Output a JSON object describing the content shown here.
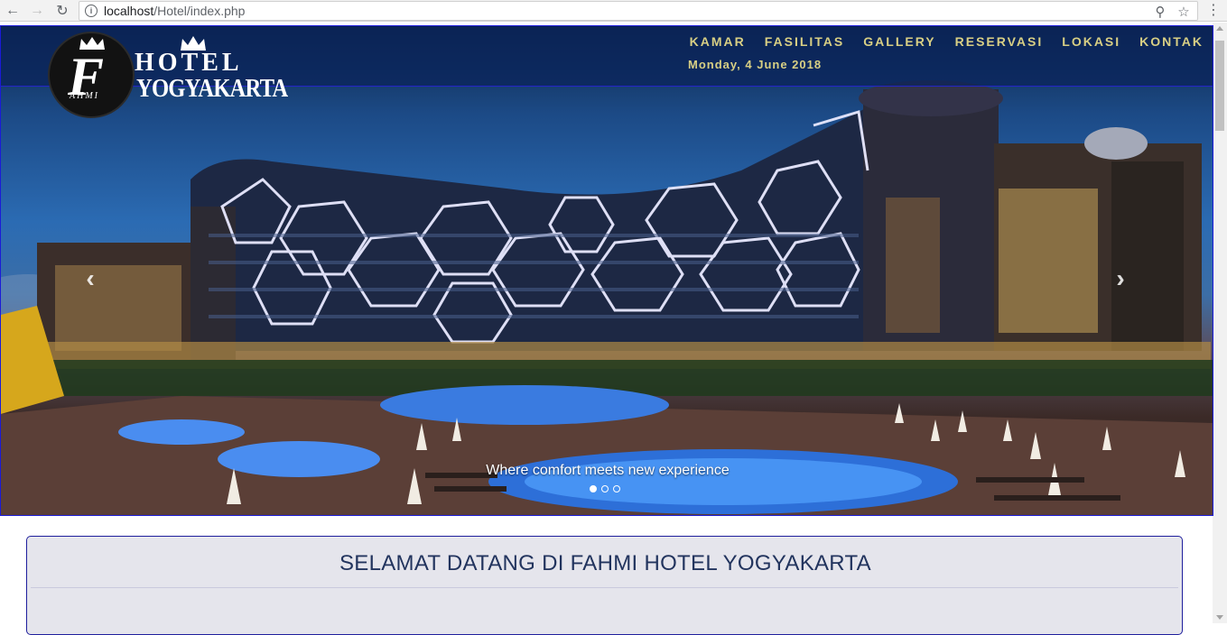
{
  "browser": {
    "url_host": "localhost",
    "url_path": "/Hotel/index.php"
  },
  "brand": {
    "logo_letter": "F",
    "logo_sub": "AHMI",
    "word1": "HOTEL",
    "word2": "YOGYAKARTA"
  },
  "nav": {
    "items": [
      "KAMAR",
      "FASILITAS",
      "GALLERY",
      "RESERVASI",
      "LOKASI",
      "KONTAK"
    ],
    "date": "Monday, 4 June 2018"
  },
  "carousel": {
    "caption": "Where comfort meets new experience",
    "slide_count": 3,
    "active_slide": 1
  },
  "welcome": {
    "title": "SELAMAT DATANG DI FAHMI HOTEL YOGYAKARTA"
  },
  "colors": {
    "nav_text": "#d8cf84",
    "panel_border": "#1e1e9c",
    "title_text": "#22345e"
  }
}
